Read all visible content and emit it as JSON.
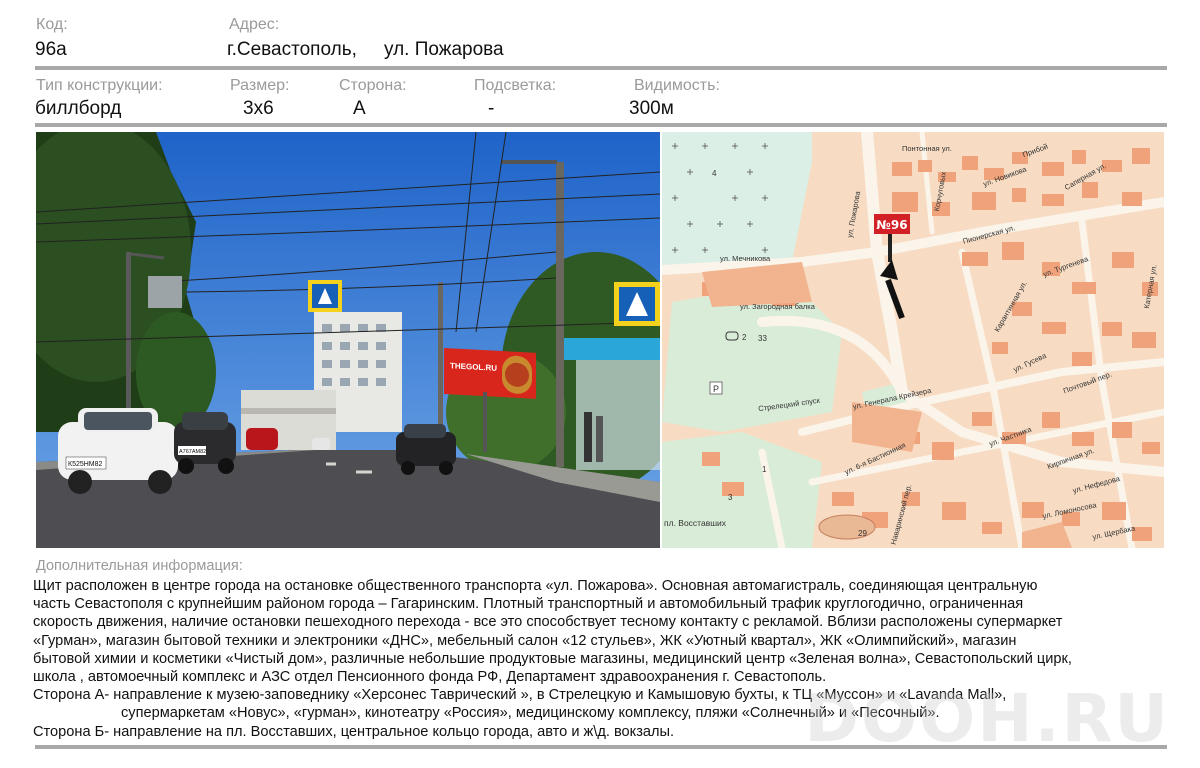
{
  "header": {
    "code_label": "Код:",
    "code_value": "96а",
    "address_label": "Адрес:",
    "address_city": "г.Севастополь,",
    "address_street": "ул. Пожарова"
  },
  "specs": {
    "type_label": "Тип конструкции:",
    "type_value": "биллборд",
    "size_label": "Размер:",
    "size_value": "3х6",
    "side_label": "Сторона:",
    "side_value": "А",
    "light_label": "Подсветка:",
    "light_value": "-",
    "visibility_label": "Видимость:",
    "visibility_value": "300м"
  },
  "photo": {
    "billboard_text": "THEGOL.RU",
    "plate_1": "К525НМ82",
    "plate_2": "А767АМ82"
  },
  "map": {
    "marker": "№96",
    "streets": [
      "Понтонная ул.",
      "ул. Новикова",
      "Прибой",
      "Саперная ул.",
      "Корчуговых",
      "ул. Пожарова",
      "Пионерская ул.",
      "ул. Мечникова",
      "ул. Загородная балка",
      "Карантинная ул.",
      "Стрелецкий спуск",
      "ул. Генерала Крейзера",
      "ул. 6-я Бастионная",
      "ул. Частника",
      "Кирпичная ул.",
      "ул. Нефедова",
      "пл. Восставших",
      "ул. Щербака",
      "ул. Гусева",
      "Почтовый пер.",
      "Катерная ул.",
      "ул. Тургенева",
      "ул. Ломоносова",
      "Наваринский пер."
    ],
    "numbers": [
      "2",
      "33",
      "29",
      "3",
      "1",
      "4"
    ],
    "parking": "P"
  },
  "info": {
    "heading": "Дополнительная информация:",
    "lines": [
      "Щит расположен в центре города на остановке  общественного транспорта «ул. Пожарова».  Основная автомагистраль, соединяющая  центральную",
      "часть Севастополя с  крупнейшим  районом города   – Гагаринским.  Плотный транспортный и автомобильный трафик круглогодично, ограниченная",
      "скорость движения, наличие остановки пешеходного перехода - все это способствует тесному контакту с рекламой.  Вблизи расположены  супермаркет",
      "«Гурман», магазин бытовой техники и электроники «ДНС», мебельный салон «12 стульев», ЖК «Уютный квартал», ЖК «Олимпийский»,      магазин",
      "бытовой химии и косметики «Чистый дом», различные небольшие продуктовые магазины, медицинский центр «Зеленая волна», Севастопольский  цирк,",
      "школа , автомоечный комплекс и АЗС отдел Пенсионного фонда РФ, Департамент здравоохранения г. Севастополь."
    ],
    "side_a_1": "Сторона А- направление к  музею-заповеднику  «Херсонес Таврический », в Стрелецкую и Камышовую бухты, к ТЦ «Муссон» и «Lavanda Mall»,",
    "side_a_2": "супермаркетам «Новус», «гурман», кинотеатру «Россия», медицинскому комплексу,  пляжи «Солнечный» и «Песочный».",
    "side_b": "Сторона Б- направление на пл. Восставших, центральное кольцо города,  авто и ж\\д. вокзалы."
  },
  "watermark": "DOOH.RU"
}
